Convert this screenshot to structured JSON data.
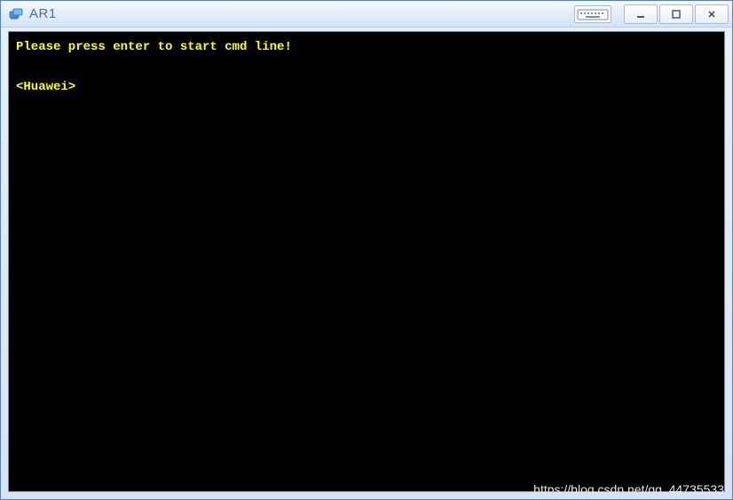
{
  "window": {
    "title": "AR1"
  },
  "terminal": {
    "line1": "Please press enter to start cmd line!",
    "prompt": "<Huawei>"
  },
  "watermark": {
    "text": "https://blog.csdn.net/qq_44735533"
  },
  "colors": {
    "terminal_bg": "#000000",
    "terminal_text": "#ffff00",
    "titlebar_text": "#4a6fa5"
  }
}
